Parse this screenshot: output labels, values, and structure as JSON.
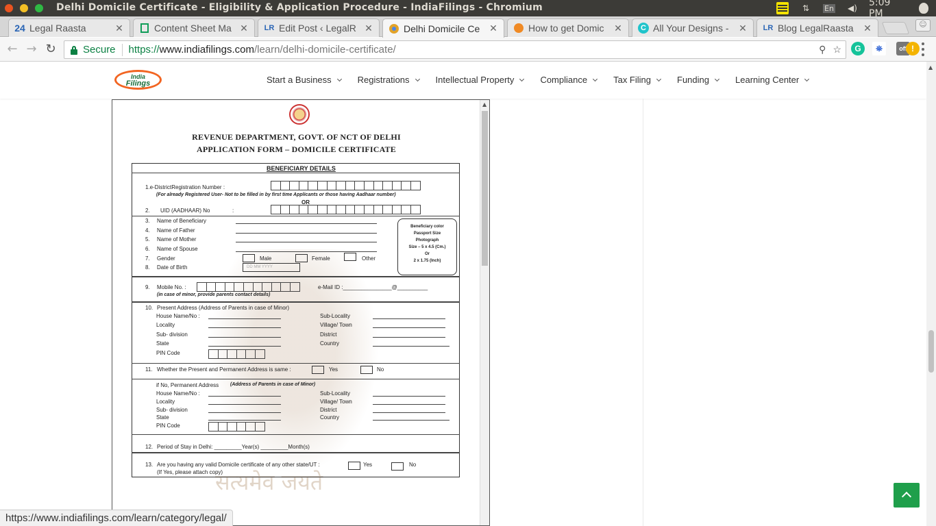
{
  "window": {
    "title": "Delhi Domicile Certificate - Eligibility & Application Procedure - IndiaFilings - Chromium"
  },
  "tray": {
    "keyboard": "En",
    "clock": "5:09 PM"
  },
  "tabs": [
    {
      "label": "Legal Raasta",
      "icon": "24"
    },
    {
      "label": "Content Sheet Ma",
      "icon": "sheets"
    },
    {
      "label": "Edit Post ‹ LegalR",
      "icon": "LR"
    },
    {
      "label": "Delhi Domicile Ce",
      "icon": "chrome"
    },
    {
      "label": "How to get Domic",
      "icon": "orange"
    },
    {
      "label": "All Your Designs -",
      "icon": "C"
    },
    {
      "label": "Blog LegalRaasta",
      "icon": "LR"
    }
  ],
  "omnibox": {
    "secure_label": "Secure",
    "scheme": "https://",
    "host": "www.indiafilings.com",
    "path": "/learn/delhi-domicile-certificate/"
  },
  "site": {
    "logo_line1": "India",
    "logo_line2": "Filings",
    "menu": [
      "Start a Business",
      "Registrations",
      "Intellectual Property",
      "Compliance",
      "Tax Filing",
      "Funding",
      "Learning Center"
    ]
  },
  "form": {
    "title1": "REVENUE DEPARTMENT, GOVT. OF NCT OF DELHI",
    "title2": "APPLICATION FORM – DOMICILE CERTIFICATE",
    "section": "BENEFICIARY DETAILS",
    "f1": "1.e-DistrictRegistration Number :",
    "f1_note": "(For already Registered User- Not to be filled in by first time Applicants or those having Aadhaar number)",
    "or": "OR",
    "f2_num": "2.",
    "f2": "UID (AADHAAR) No",
    "colon": ":",
    "rows": [
      {
        "num": "3.",
        "label": "Name of Beneficiary"
      },
      {
        "num": "4.",
        "label": "Name of Father"
      },
      {
        "num": "5.",
        "label": "Name of Mother"
      },
      {
        "num": "6.",
        "label": "Name of Spouse"
      }
    ],
    "g_num": "7.",
    "gender": "Gender",
    "male": "Male",
    "female": "Female",
    "other": "Other",
    "dob_num": "8.",
    "dob": "Date of Birth",
    "dob_hint": "DD   MM   YYYY",
    "photo": [
      "Beneficiary color",
      "Passport Size",
      "Photograph",
      "Size – 5 x 4.5 (Cm.)",
      "Or",
      "2 x 1.75 (Inch)"
    ],
    "mobile": "Mobile No. :",
    "mobile_num": "9.",
    "email": "e-Mail ID :________________@__________",
    "mobile_note": "(in case of minor, provide parents contact details)",
    "present_num": "10.",
    "present": "Present Address   (Address of Parents in case of Minor)",
    "addr_left": [
      "House Name/No :",
      "Locality",
      "Sub- division",
      "State",
      "PIN Code"
    ],
    "addr_right": [
      "Sub-Locality",
      "Village/ Town",
      "District",
      "Country"
    ],
    "same_num": "11.",
    "same": "Whether the Present and Permanent Address is same :",
    "yes": "Yes",
    "no": "No",
    "perm": "if No, Permanent Address",
    "perm_note": "(Address of Parents in case of Minor)",
    "stay_num": "12.",
    "stay": "Period of Stay in Delhi: _________Year(s)   _________Month(s)",
    "dom_num": "13.",
    "dom": "Are you having any valid Domicile certificate of any other state/UT :",
    "dom_note": "(If Yes, please attach copy)",
    "watermark": "सत्यमेव जयते"
  },
  "status": {
    "url": "https://www.indiafilings.com/learn/category/legal/"
  },
  "colors": {
    "titlebar": "#3c3b37",
    "secure": "#0b8043",
    "totop": "#1f9f4b",
    "logo_ring": "#f26522"
  }
}
